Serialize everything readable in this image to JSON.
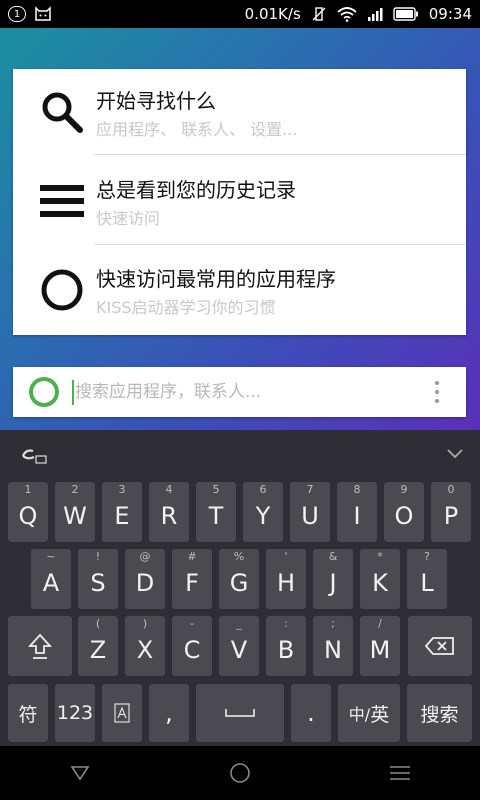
{
  "status_bar": {
    "notification_count": "1",
    "network_speed": "0.01K/s",
    "time": "09:34"
  },
  "hints": [
    {
      "title": "开始寻找什么",
      "subtitle": "应用程序、 联系人、 设置...",
      "icon": "search-icon"
    },
    {
      "title": "总是看到您的历史记录",
      "subtitle": "快速访问",
      "icon": "history-icon"
    },
    {
      "title": "快速访问最常用的应用程序",
      "subtitle": "KISS启动器学习你的习惯",
      "icon": "circle-icon"
    }
  ],
  "search": {
    "placeholder": "搜索应用程序，联系人..."
  },
  "keyboard": {
    "row1": [
      {
        "hint": "1",
        "label": "Q"
      },
      {
        "hint": "2",
        "label": "W"
      },
      {
        "hint": "3",
        "label": "E"
      },
      {
        "hint": "4",
        "label": "R"
      },
      {
        "hint": "5",
        "label": "T"
      },
      {
        "hint": "6",
        "label": "Y"
      },
      {
        "hint": "7",
        "label": "U"
      },
      {
        "hint": "8",
        "label": "I"
      },
      {
        "hint": "9",
        "label": "O"
      },
      {
        "hint": "0",
        "label": "P"
      }
    ],
    "row2": [
      {
        "hint": "~",
        "label": "A"
      },
      {
        "hint": "!",
        "label": "S"
      },
      {
        "hint": "@",
        "label": "D"
      },
      {
        "hint": "#",
        "label": "F"
      },
      {
        "hint": "%",
        "label": "G"
      },
      {
        "hint": "'",
        "label": "H"
      },
      {
        "hint": "&",
        "label": "J"
      },
      {
        "hint": "*",
        "label": "K"
      },
      {
        "hint": "?",
        "label": "L"
      }
    ],
    "row3": [
      {
        "hint": "(",
        "label": "Z"
      },
      {
        "hint": ")",
        "label": "X"
      },
      {
        "hint": "-",
        "label": "C"
      },
      {
        "hint": "_",
        "label": "V"
      },
      {
        "hint": ":",
        "label": "B"
      },
      {
        "hint": ";",
        "label": "N"
      },
      {
        "hint": "/",
        "label": "M"
      }
    ],
    "symbols_label": "符",
    "numbers_label": "123",
    "comma_label": ",",
    "period_label": ".",
    "lang_label_a": "中/",
    "lang_label_b": "英",
    "search_label": "搜索"
  },
  "colors": {
    "accent": "#4caf50",
    "keyboard_bg": "#2e2e34",
    "key_bg": "#4a4a50"
  }
}
